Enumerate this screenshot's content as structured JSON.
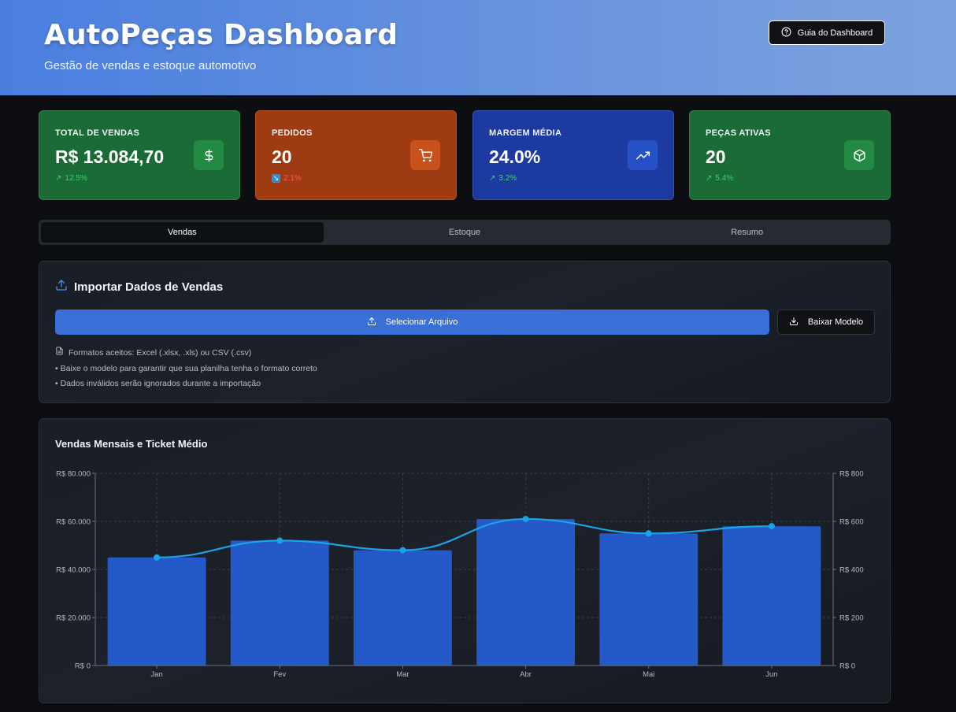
{
  "header": {
    "title": "AutoPeças Dashboard",
    "subtitle": "Gestão de vendas e estoque automotivo",
    "guide_label": "Guia do Dashboard"
  },
  "cards": [
    {
      "title": "TOTAL DE VENDAS",
      "value": "R$ 13.084,70",
      "delta": "12.5%",
      "delta_direction": "up",
      "icon": "dollar-icon",
      "color": "#1a6b35"
    },
    {
      "title": "PEDIDOS",
      "value": "20",
      "delta": "2.1%",
      "delta_direction": "down",
      "icon": "cart-icon",
      "color": "#9e3b12"
    },
    {
      "title": "MARGEM MÉDIA",
      "value": "24.0%",
      "delta": "3.2%",
      "delta_direction": "up",
      "icon": "trending-up-icon",
      "color": "#1d3aa0"
    },
    {
      "title": "PEÇAS ATIVAS",
      "value": "20",
      "delta": "5.4%",
      "delta_direction": "up",
      "icon": "package-icon",
      "color": "#1a6b35"
    }
  ],
  "tabs": [
    {
      "label": "Vendas",
      "active": true
    },
    {
      "label": "Estoque",
      "active": false
    },
    {
      "label": "Resumo",
      "active": false
    }
  ],
  "import": {
    "title": "Importar Dados de Vendas",
    "select_label": "Selecionar Arquivo",
    "download_label": "Baixar Modelo",
    "info": [
      "Formatos aceitos: Excel (.xlsx, .xls) ou CSV (.csv)",
      "• Baixe o modelo para garantir que sua planilha tenha o formato correto",
      "• Dados inválidos serão ignorados durante a importação"
    ]
  },
  "chart_data": {
    "type": "bar",
    "title": "Vendas Mensais e Ticket Médio",
    "categories": [
      "Jan",
      "Fev",
      "Mar",
      "Abr",
      "Mai",
      "Jun"
    ],
    "series": [
      {
        "type": "bar",
        "axis": "left",
        "color": "#2459c9",
        "values": [
          45000,
          52000,
          48000,
          61000,
          55000,
          58000
        ]
      },
      {
        "type": "line",
        "axis": "right",
        "color": "#1ba3e8",
        "values": [
          450,
          520,
          480,
          610,
          550,
          580
        ]
      }
    ],
    "ylim_left": [
      0,
      80000
    ],
    "ylim_right": [
      0,
      800
    ],
    "yticks_left": [
      "R$ 0",
      "R$ 20.000",
      "R$ 40.000",
      "R$ 60.000",
      "R$ 80.000"
    ],
    "yticks_right": [
      "R$ 0",
      "R$ 200",
      "R$ 400",
      "R$ 600",
      "R$ 800"
    ],
    "grid": true
  }
}
